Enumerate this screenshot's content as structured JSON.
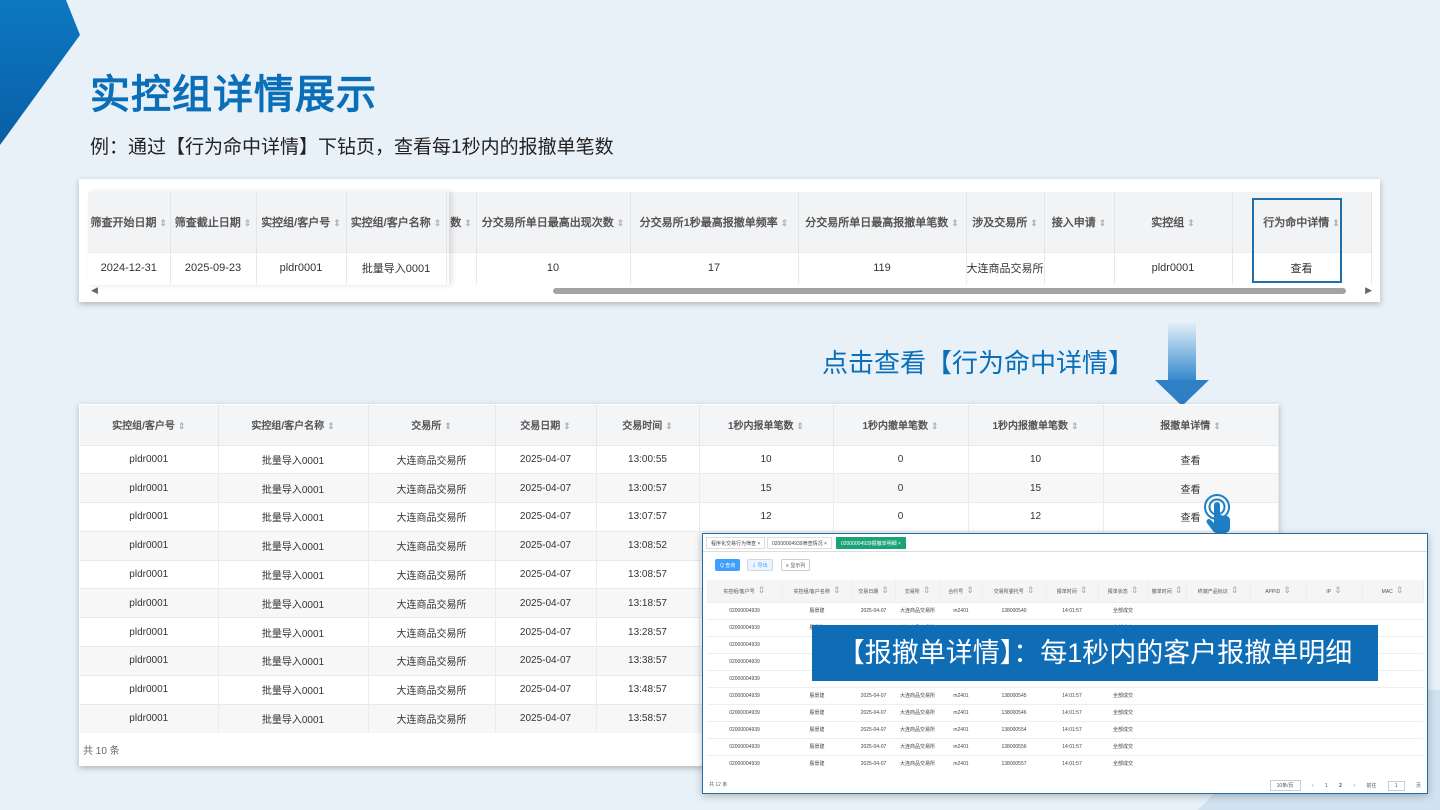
{
  "page": {
    "title": "实控组详情展示",
    "subtitle": "例：通过【行为命中详情】下钻页，查看每1秒内的报撤单笔数",
    "click_caption": "点击查看【行为命中详情】",
    "callout": "【报撤单详情】：每1秒内的客户报撤单明细"
  },
  "table1": {
    "headers": [
      "筛查开始日期",
      "筛查截止日期",
      "实控组/客户号",
      "实控组/客户名称",
      "数",
      "分交易所单日最高出现次数",
      "分交易所1秒最高报撤单频率",
      "分交易所单日最高报撤单笔数",
      "涉及交易所",
      "接入申请",
      "实控组",
      "行为命中详情"
    ],
    "row": [
      "2024-12-31",
      "2025-09-23",
      "pldr0001",
      "批量导入0001",
      "",
      "10",
      "17",
      "119",
      "大连商品交易所",
      "",
      "pldr0001",
      "查看"
    ]
  },
  "table2": {
    "headers": [
      "实控组/客户号",
      "实控组/客户名称",
      "交易所",
      "交易日期",
      "交易时间",
      "1秒内报单笔数",
      "1秒内撤单笔数",
      "1秒内报撤单笔数",
      "报撤单详情"
    ],
    "rows": [
      [
        "pldr0001",
        "批量导入0001",
        "大连商品交易所",
        "2025-04-07",
        "13:00:55",
        "10",
        "0",
        "10",
        "查看"
      ],
      [
        "pldr0001",
        "批量导入0001",
        "大连商品交易所",
        "2025-04-07",
        "13:00:57",
        "15",
        "0",
        "15",
        "查看"
      ],
      [
        "pldr0001",
        "批量导入0001",
        "大连商品交易所",
        "2025-04-07",
        "13:07:57",
        "12",
        "0",
        "12",
        "查看"
      ],
      [
        "pldr0001",
        "批量导入0001",
        "大连商品交易所",
        "2025-04-07",
        "13:08:52",
        "",
        "",
        "",
        ""
      ],
      [
        "pldr0001",
        "批量导入0001",
        "大连商品交易所",
        "2025-04-07",
        "13:08:57",
        "",
        "",
        "",
        ""
      ],
      [
        "pldr0001",
        "批量导入0001",
        "大连商品交易所",
        "2025-04-07",
        "13:18:57",
        "",
        "",
        "",
        ""
      ],
      [
        "pldr0001",
        "批量导入0001",
        "大连商品交易所",
        "2025-04-07",
        "13:28:57",
        "",
        "",
        "",
        ""
      ],
      [
        "pldr0001",
        "批量导入0001",
        "大连商品交易所",
        "2025-04-07",
        "13:38:57",
        "",
        "",
        "",
        ""
      ],
      [
        "pldr0001",
        "批量导入0001",
        "大连商品交易所",
        "2025-04-07",
        "13:48:57",
        "",
        "",
        "",
        ""
      ],
      [
        "pldr0001",
        "批量导入0001",
        "大连商品交易所",
        "2025-04-07",
        "13:58:57",
        "",
        "",
        "",
        ""
      ]
    ],
    "total": "共 10 条"
  },
  "detail": {
    "tabs": [
      "程序化交易行为筛查 ×",
      "02000004939筛查情况 ×",
      "02000004939报撤单明细 ×"
    ],
    "buttons": [
      "Q 查询",
      "⇩ 导出",
      "≡ 显示列"
    ],
    "headers": [
      "实控组/客户号",
      "实控组/客户名称",
      "交易日期",
      "交易所",
      "合约号",
      "交易所委托号",
      "报单时间",
      "报单状态",
      "撤单时间",
      "终端产品标识",
      "APPID",
      "IP",
      "MAC"
    ],
    "rows": [
      [
        "02000004939",
        "殷景建",
        "2025-04-07",
        "大连商品交易所",
        "m2401",
        "138000540",
        "14:01:57",
        "全部成交",
        "",
        "",
        "",
        "",
        ""
      ],
      [
        "02000004939",
        "殷景建",
        "2025-04-07",
        "大连商品交易所",
        "m2401",
        "138000541",
        "14:01:57",
        "全部成交",
        "",
        "",
        "",
        "",
        ""
      ],
      [
        "02000004939",
        "",
        "",
        "",
        "",
        "",
        "",
        "",
        "",
        "",
        "",
        "",
        ""
      ],
      [
        "02000004939",
        "",
        "",
        "",
        "",
        "",
        "",
        "",
        "",
        "",
        "",
        "",
        ""
      ],
      [
        "02000004939",
        "",
        "",
        "",
        "",
        "",
        "",
        "",
        "",
        "",
        "",
        "",
        ""
      ],
      [
        "02000004939",
        "殷景建",
        "2025-04-07",
        "大连商品交易所",
        "m2401",
        "138000545",
        "14:01:57",
        "全部成交",
        "",
        "",
        "",
        "",
        ""
      ],
      [
        "02000004939",
        "殷景建",
        "2025-04-07",
        "大连商品交易所",
        "m2401",
        "138000546",
        "14:01:57",
        "全部成交",
        "",
        "",
        "",
        "",
        ""
      ],
      [
        "02000004939",
        "殷景建",
        "2025-04-07",
        "大连商品交易所",
        "m2401",
        "138000554",
        "14:01:57",
        "全部成交",
        "",
        "",
        "",
        "",
        ""
      ],
      [
        "02000004939",
        "殷景建",
        "2025-04-07",
        "大连商品交易所",
        "m2401",
        "138000556",
        "14:01:57",
        "全部成交",
        "",
        "",
        "",
        "",
        ""
      ],
      [
        "02000004939",
        "殷景建",
        "2025-04-07",
        "大连商品交易所",
        "m2401",
        "138000557",
        "14:01:57",
        "全部成交",
        "",
        "",
        "",
        "",
        ""
      ]
    ],
    "total": "共 12 条",
    "pager": {
      "page_size": "10条/页",
      "prev": "‹",
      "pages": [
        "1",
        "2"
      ],
      "next": "›",
      "goto_label": "前往",
      "goto_value": "1",
      "goto_suffix": "页"
    }
  },
  "colors": {
    "accent": "#0a6fb8",
    "link": "#1677cc",
    "highlight": "#1f6fad",
    "tab_active": "#1aa37a"
  }
}
